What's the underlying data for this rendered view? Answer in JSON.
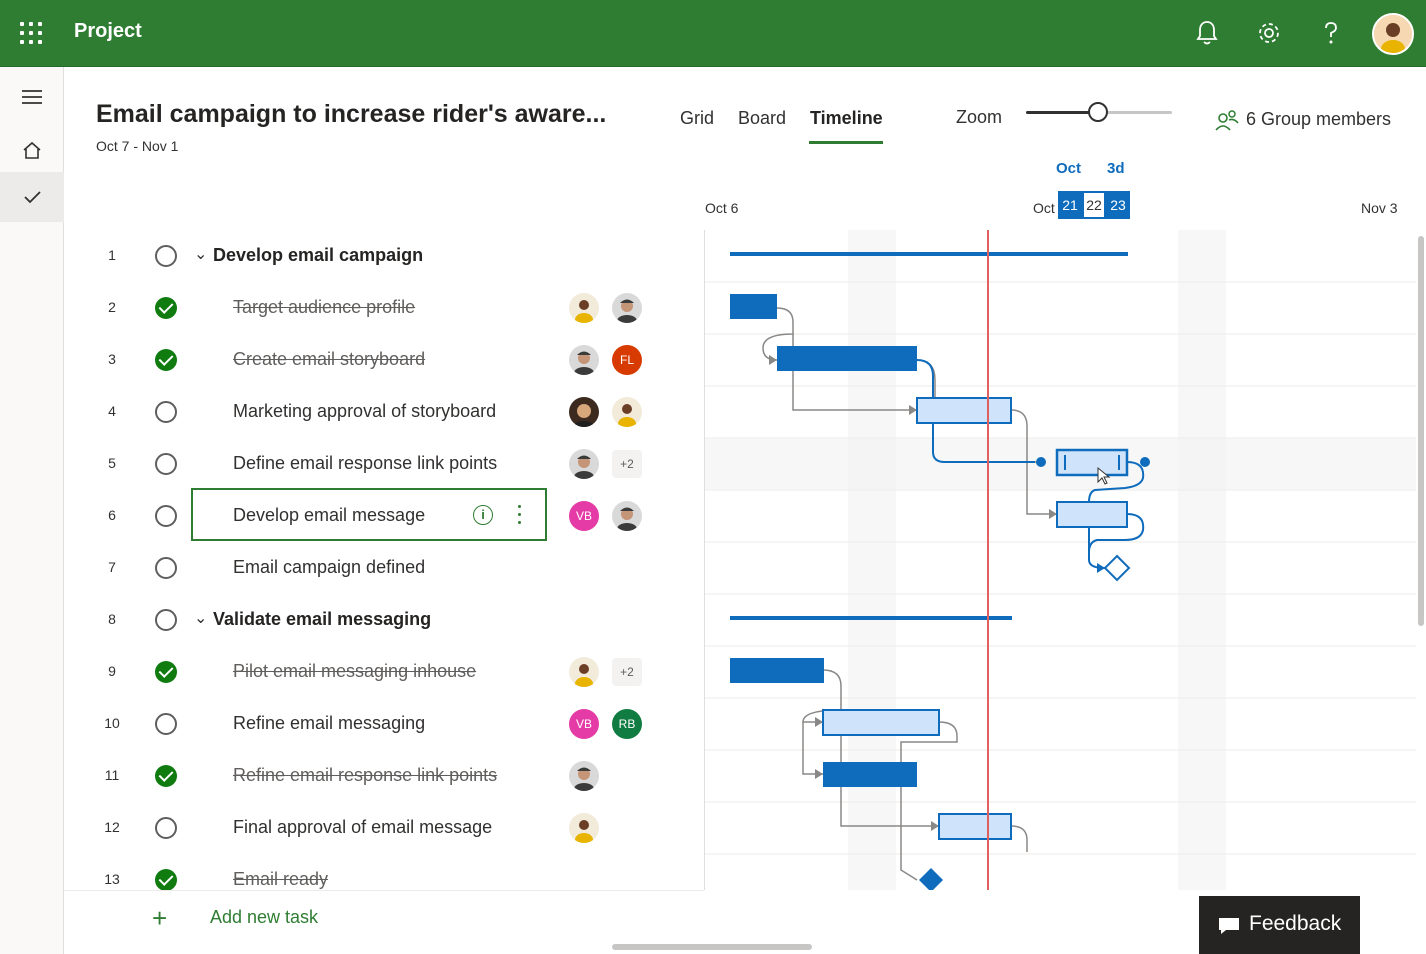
{
  "app": {
    "title": "Project"
  },
  "topbar": {
    "icons": [
      "waffle-icon",
      "bell-icon",
      "gear-icon",
      "help-icon",
      "user-avatar"
    ],
    "color": "#2f7d32"
  },
  "leftrail": {
    "items": [
      "menu-icon",
      "home-icon",
      "check-icon"
    ]
  },
  "plan": {
    "title": "Email campaign to increase rider's aware...",
    "dates": "Oct 7 - Nov 1"
  },
  "views": {
    "tabs": [
      {
        "label": "Grid",
        "active": false
      },
      {
        "label": "Board",
        "active": false
      },
      {
        "label": "Timeline",
        "active": true
      }
    ]
  },
  "zoom": {
    "label": "Zoom",
    "level": 0.5
  },
  "members": {
    "label": "6 Group members"
  },
  "timeline_header": {
    "start_label": "Oct 6",
    "end_label": "Nov 3",
    "month": "Oct",
    "range": "3d",
    "partial_label": "Oct",
    "days": [
      "21",
      "22",
      "23"
    ]
  },
  "tasks": [
    {
      "num": "1",
      "name": "Develop email campaign",
      "bucket": true,
      "done": false
    },
    {
      "num": "2",
      "name": "Target audience profile",
      "done": true
    },
    {
      "num": "3",
      "name": "Create email storyboard",
      "done": true
    },
    {
      "num": "4",
      "name": "Marketing approval of storyboard",
      "done": false
    },
    {
      "num": "5",
      "name": "Define email response link points",
      "done": false
    },
    {
      "num": "6",
      "name": "Develop email message",
      "done": false,
      "selected": true
    },
    {
      "num": "7",
      "name": "Email campaign defined",
      "done": false
    },
    {
      "num": "8",
      "name": "Validate email messaging",
      "bucket": true,
      "done": false
    },
    {
      "num": "9",
      "name": "Pilot email messaging inhouse",
      "done": true
    },
    {
      "num": "10",
      "name": "Refine email messaging",
      "done": false
    },
    {
      "num": "11",
      "name": "Refine email response link points",
      "done": true
    },
    {
      "num": "12",
      "name": "Final approval of email message",
      "done": false
    },
    {
      "num": "13",
      "name": "Email ready",
      "done": true
    }
  ],
  "assignees": {
    "initials_fl": "FL",
    "initials_vb": "VB",
    "initials_rb": "RB",
    "more_plus2": "+2"
  },
  "add_task": {
    "label": "Add new task"
  },
  "feedback": {
    "label": "Feedback"
  },
  "colors": {
    "accent": "#2f7d32",
    "bar_blue": "#0f6cbd",
    "bar_light": "#cfe4fa",
    "today_line": "#e06060",
    "complete_green": "#107c10"
  }
}
